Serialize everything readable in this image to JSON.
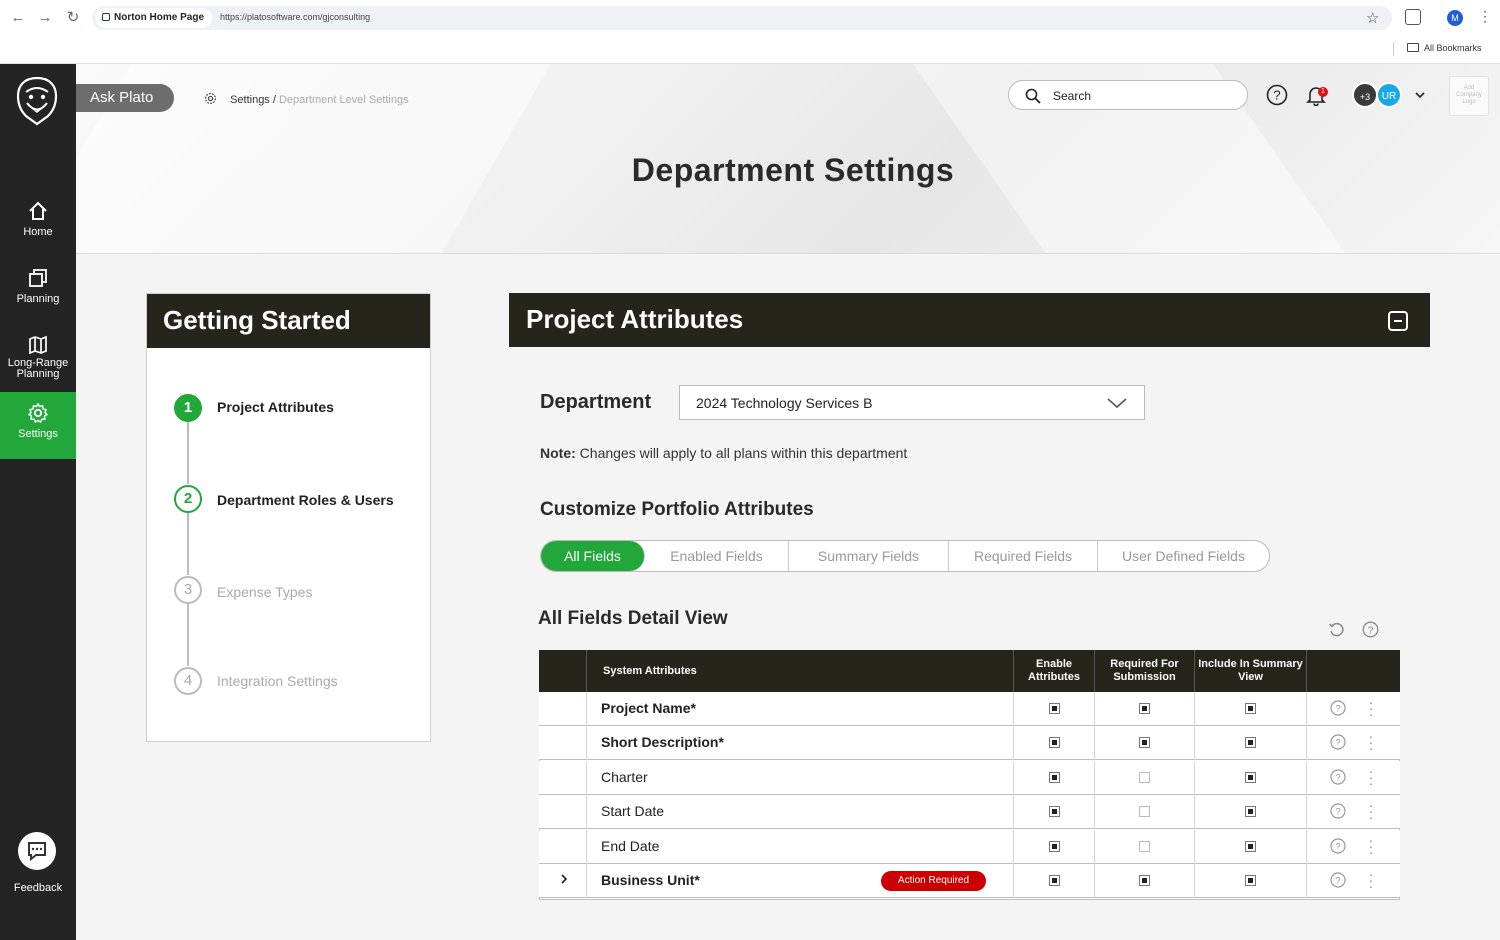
{
  "browser": {
    "tab_site": "Norton Home Page",
    "url": "https://platosoftware.com/gjconsulting",
    "profile_initial": "M",
    "bookmarks_label": "All Bookmarks"
  },
  "sidebar": {
    "items": [
      {
        "label": "Home",
        "icon": "home-icon"
      },
      {
        "label": "Planning",
        "icon": "planning-icon"
      },
      {
        "label": "Long-Range Planning",
        "icon": "map-icon"
      },
      {
        "label": "Settings",
        "icon": "gear-icon",
        "active": true
      }
    ],
    "feedback_label": "Feedback"
  },
  "header": {
    "ask_plato": "Ask Plato",
    "breadcrumb_root": "Settings /",
    "breadcrumb_current": "Department Level Settings",
    "search_placeholder": "Search",
    "notification_count": "1",
    "avatar_more": "+3",
    "avatar_initials": "UR",
    "company_logo_text": "Add Company Logo",
    "page_title": "Department Settings"
  },
  "getting_started": {
    "title": "Getting Started",
    "steps": [
      {
        "number": "1",
        "label": "Project Attributes",
        "state": "current"
      },
      {
        "number": "2",
        "label": "Department Roles & Users",
        "state": "next"
      },
      {
        "number": "3",
        "label": "Expense Types",
        "state": "pending"
      },
      {
        "number": "4",
        "label": "Integration Settings",
        "state": "pending"
      }
    ]
  },
  "project_attributes": {
    "title": "Project Attributes",
    "department_label": "Department",
    "department_value": "2024 Technology Services B",
    "note_bold": "Note:",
    "note_text": "Changes will apply to all plans within this department",
    "customize_title": "Customize Portfolio Attributes",
    "filter_tabs": [
      "All Fields",
      "Enabled Fields",
      "Summary Fields",
      "Required Fields",
      "User Defined Fields"
    ],
    "active_filter": "All Fields",
    "detail_title": "All Fields Detail View",
    "table": {
      "headers": {
        "system_attributes": "System Attributes",
        "enable": "Enable Attributes",
        "required": "Required For Submission",
        "summary": "Include In Summary View"
      },
      "rows": [
        {
          "name": "Project Name*",
          "bold": true,
          "enable": true,
          "required": true,
          "summary": true,
          "action_required": ""
        },
        {
          "name": "Short Description*",
          "bold": true,
          "enable": true,
          "required": true,
          "summary": true,
          "action_required": ""
        },
        {
          "name": "Charter",
          "bold": false,
          "enable": true,
          "required": false,
          "summary": true,
          "action_required": ""
        },
        {
          "name": "Start Date",
          "bold": false,
          "enable": true,
          "required": false,
          "summary": true,
          "action_required": ""
        },
        {
          "name": "End Date",
          "bold": false,
          "enable": true,
          "required": false,
          "summary": true,
          "action_required": ""
        },
        {
          "name": "Business Unit*",
          "bold": true,
          "enable": true,
          "required": true,
          "summary": true,
          "action_required": "Action Required",
          "expandable": true
        }
      ]
    }
  },
  "colors": {
    "accent_green": "#22a83a",
    "dark_header": "#26251c",
    "sidebar_bg": "#242424",
    "alert_red": "#cc0000"
  }
}
